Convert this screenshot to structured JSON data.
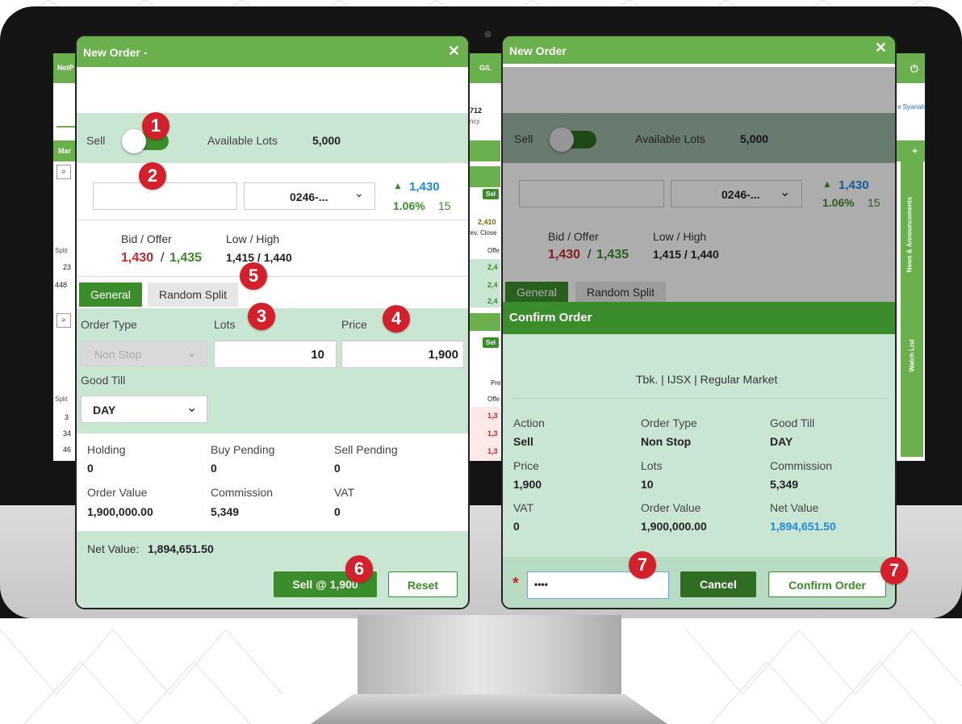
{
  "bg_app": {
    "brand": "NetP",
    "gl_label": "G/L",
    "ticker_value": "712",
    "ticker_sub": "ncy",
    "market_tab": "Mar",
    "syariah_label": "e Syariah",
    "split_label": "Split",
    "split_values_top": [
      "23",
      "448"
    ],
    "split_values_bottom": [
      "3",
      "34",
      "46"
    ],
    "sel_label": "Sel",
    "prev_close_value": "2,410",
    "prev_close_label": "rev. Close",
    "offer_label": "Offe",
    "offer_values_top": [
      "2,4",
      "2,4",
      "2,4"
    ],
    "pre_label": "Pre",
    "offer_values_bottom": [
      "1,3",
      "1,3",
      "1,3"
    ],
    "news_label": "News & Announcements",
    "watch_label": "Watch List",
    "plus_label": "+"
  },
  "left_dialog": {
    "title": "New Order -",
    "close": "✕",
    "side_label": "Sell",
    "available_lots_label": "Available Lots",
    "available_lots_value": "5,000",
    "account_value": "0246-...",
    "dropdown_chevron": "⌄",
    "last_price": "1,430",
    "change_pct": "1.06%",
    "change_val": "15",
    "bid_offer_label": "Bid / Offer",
    "bid": "1,430",
    "offer": "1,435",
    "low_high_label": "Low / High",
    "low_high_value": "1,415 / 1,440",
    "tab_general": "General",
    "tab_random": "Random Split",
    "order_type_label": "Order Type",
    "order_type_value": "Non Stop",
    "lots_label": "Lots",
    "lots_value": "10",
    "price_label": "Price",
    "price_value": "1,900",
    "good_till_label": "Good Till",
    "good_till_value": "DAY",
    "holding_label": "Holding",
    "holding_value": "0",
    "buy_pending_label": "Buy Pending",
    "buy_pending_value": "0",
    "sell_pending_label": "Sell Pending",
    "sell_pending_value": "0",
    "order_value_label": "Order Value",
    "order_value_value": "1,900,000.00",
    "commission_label": "Commission",
    "commission_value": "5,349",
    "vat_label": "VAT",
    "vat_value": "0",
    "net_value_label": "Net Value:",
    "net_value_value": "1,894,651.50",
    "sell_button": "Sell @ 1,900",
    "reset_button": "Reset"
  },
  "right_dialog": {
    "title": "New Order",
    "close": "✕",
    "side_label": "Sell",
    "available_lots_label": "Available Lots",
    "available_lots_value": "5,000",
    "account_value": "0246-...",
    "last_price": "1,430",
    "change_pct": "1.06%",
    "change_val": "15",
    "bid_offer_label": "Bid / Offer",
    "bid": "1,430",
    "offer": "1,435",
    "low_high_label": "Low / High",
    "low_high_value": "1,415 / 1,440",
    "tab_general": "General",
    "tab_random": "Random Split",
    "confirm_title": "Confirm Order",
    "market_line": "Tbk.  | IJSX  | Regular Market",
    "action_label": "Action",
    "action_value": "Sell",
    "order_type_label": "Order Type",
    "order_type_value": "Non Stop",
    "good_till_label": "Good Till",
    "good_till_value": "DAY",
    "price_label": "Price",
    "price_value": "1,900",
    "lots_label": "Lots",
    "lots_value": "10",
    "commission_label": "Commission",
    "commission_value": "5,349",
    "vat_label": "VAT",
    "vat_value": "0",
    "order_value_label": "Order Value",
    "order_value_value": "1,900,000.00",
    "net_value_label": "Net Value",
    "net_value_value": "1,894,651.50",
    "required_mark": "*",
    "pin_value": "••••",
    "cancel_button": "Cancel",
    "confirm_button": "Confirm Order"
  },
  "badges": [
    "1",
    "2",
    "3",
    "4",
    "5",
    "6",
    "7",
    "7"
  ],
  "colors": {
    "accent_green": "#6ab04c",
    "dark_green": "#3b8c2a",
    "panel_mint": "#c9e6d2",
    "badge_red": "#d4202a",
    "bid_red": "#c62828",
    "price_blue": "#1e88e5"
  }
}
